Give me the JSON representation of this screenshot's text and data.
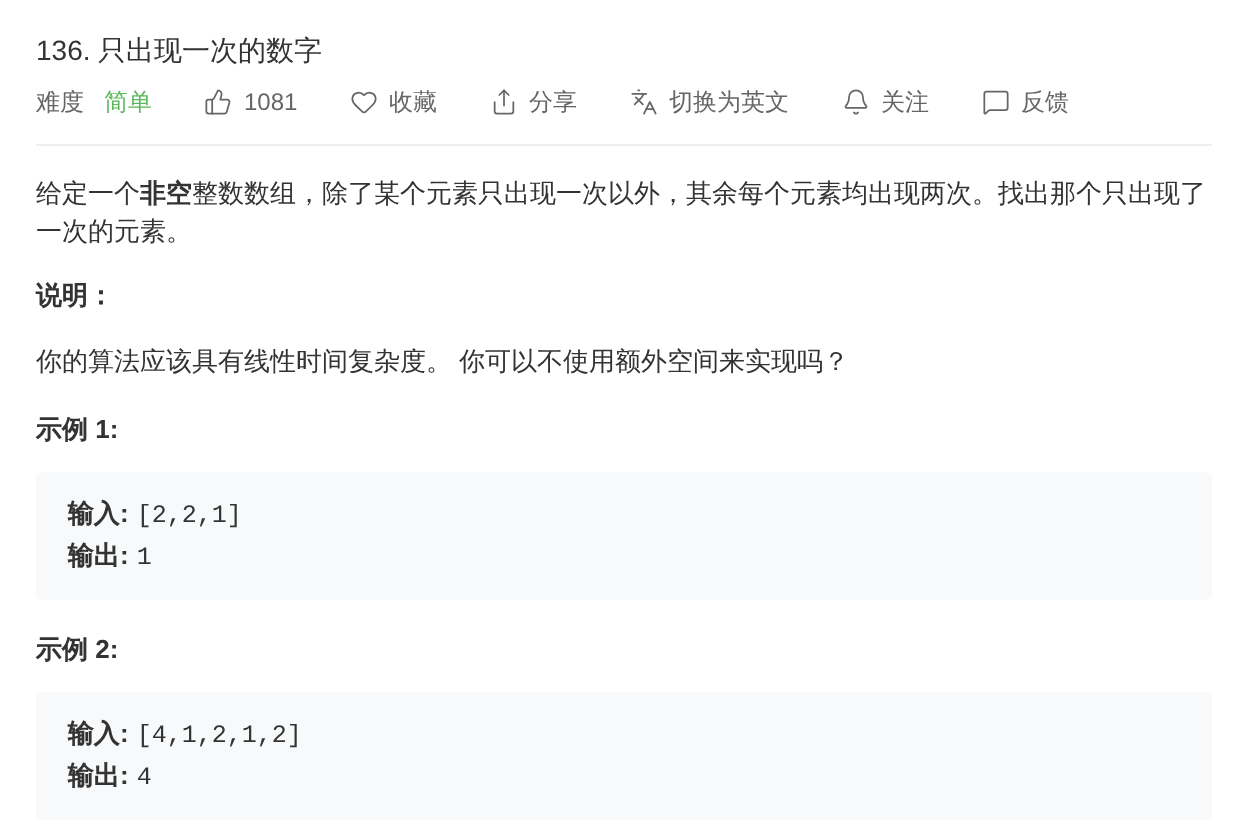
{
  "title": "136. 只出现一次的数字",
  "toolbar": {
    "difficulty_label": "难度",
    "difficulty": "简单",
    "actions": [
      {
        "kind": "like",
        "label": "1081"
      },
      {
        "kind": "favorite",
        "label": "收藏"
      },
      {
        "kind": "share",
        "label": "分享"
      },
      {
        "kind": "translate",
        "label": "切换为英文"
      },
      {
        "kind": "follow",
        "label": "关注"
      },
      {
        "kind": "feedback",
        "label": "反馈"
      }
    ]
  },
  "description": "给定一个**非空**整数数组，除了某个元素只出现一次以外，其余每个元素均出现两次。找出那个只出现了一次的元素。",
  "note_heading": "说明：",
  "note": "你的算法应该具有线性时间复杂度。 你可以不使用额外空间来实现吗？",
  "examples": [
    {
      "heading": "示例 1:",
      "lines": [
        {
          "label": "输入:",
          "value": "[2,2,1]"
        },
        {
          "label": "输出:",
          "value": "1"
        }
      ]
    },
    {
      "heading": "示例 2:",
      "lines": [
        {
          "label": "输入:",
          "value": "[4,1,2,1,2]"
        },
        {
          "label": "输出:",
          "value": "4"
        }
      ]
    }
  ]
}
